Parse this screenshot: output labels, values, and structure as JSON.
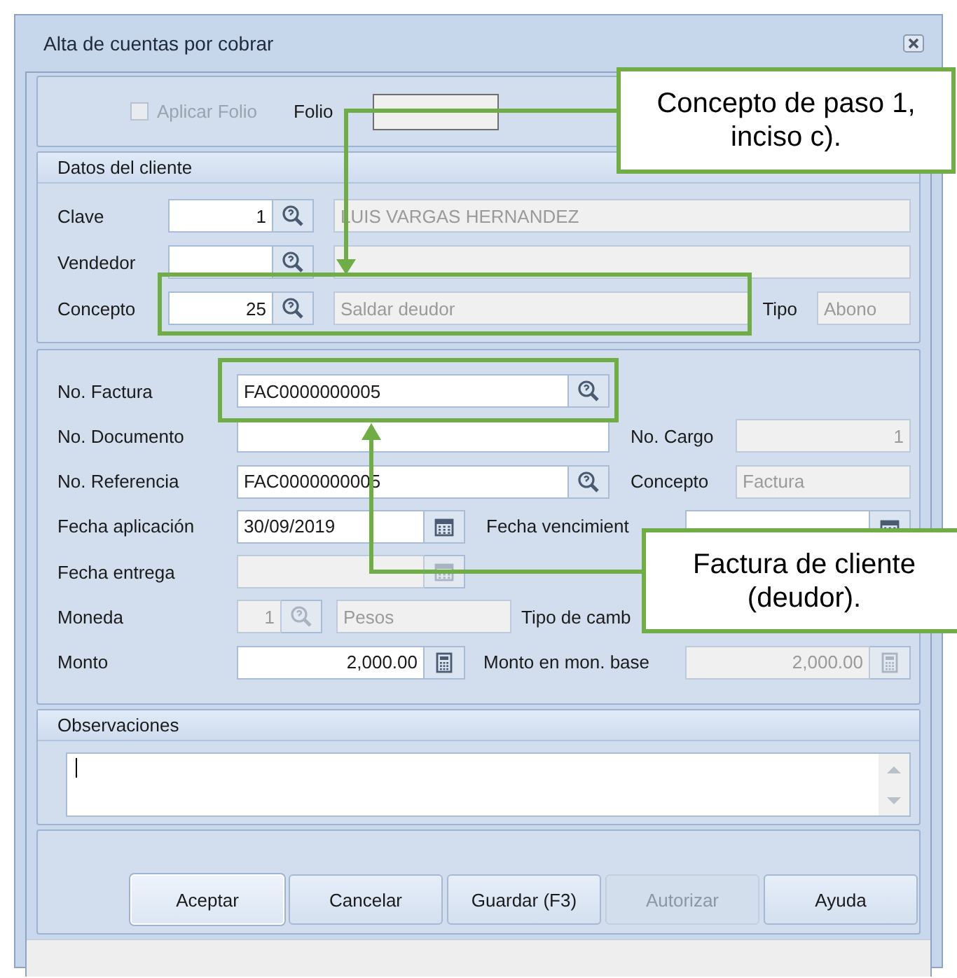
{
  "window": {
    "title": "Alta de cuentas por cobrar"
  },
  "folio": {
    "checkbox": {
      "label": "Aplicar Folio",
      "checked": false,
      "disabled": true
    },
    "label": "Folio"
  },
  "client": {
    "title": "Datos del cliente",
    "rows": [
      {
        "label": "Clave",
        "code": {
          "value": "1",
          "disabled": false
        },
        "name": {
          "value": "LUIS VARGAS HERNANDEZ",
          "disabled": true
        }
      },
      {
        "label": "Vendedor",
        "code": {
          "disabled": false
        },
        "name": {
          "disabled": true
        }
      },
      {
        "label": "Concepto",
        "code": {
          "value": "25",
          "disabled": false
        },
        "name": {
          "value": "Saldar deudor",
          "disabled": true
        },
        "type": {
          "label": "Tipo",
          "value": "Abono",
          "disabled": true
        }
      }
    ]
  },
  "document": {
    "rows": [
      {
        "label": "No. Factura",
        "input": {
          "kind": "lookup",
          "value": "FAC0000000005",
          "disabled": false
        }
      },
      {
        "label": "No. Documento",
        "input": {
          "kind": "text",
          "disabled": false
        },
        "right": {
          "label": "No. Cargo",
          "input": {
            "kind": "number",
            "value": "1",
            "disabled": true
          }
        }
      },
      {
        "label": "No. Referencia",
        "input": {
          "kind": "lookup",
          "value": "FAC0000000005",
          "disabled": false
        },
        "right": {
          "label": "Concepto",
          "input": {
            "kind": "text",
            "value": "Factura",
            "disabled": true
          }
        }
      },
      {
        "label": "Fecha aplicación",
        "input": {
          "kind": "date",
          "value": "30/09/2019",
          "disabled": false
        },
        "right": {
          "label": "Fecha vencimient",
          "input": {
            "kind": "date",
            "disabled": false
          }
        }
      },
      {
        "label": "Fecha entrega",
        "input": {
          "kind": "date",
          "disabled": true
        }
      },
      {
        "label": "Moneda",
        "input": {
          "kind": "currency",
          "value": "1",
          "name": "Pesos",
          "disabled": true
        },
        "right": {
          "label": "Tipo de camb"
        }
      },
      {
        "label": "Monto",
        "input": {
          "kind": "amount",
          "value": "2,000.00",
          "disabled": false
        },
        "right": {
          "label": "Monto en mon. base",
          "input": {
            "kind": "amount",
            "value": "2,000.00",
            "disabled": true
          }
        }
      }
    ]
  },
  "notes": {
    "title": "Observaciones"
  },
  "buttons": [
    {
      "label": "Aceptar",
      "disabled": false,
      "focused": true
    },
    {
      "label": "Cancelar",
      "disabled": false,
      "focused": false
    },
    {
      "label": "Guardar (F3)",
      "disabled": false,
      "focused": false
    },
    {
      "label": "Autorizar",
      "disabled": true,
      "focused": false
    },
    {
      "label": "Ayuda",
      "disabled": false,
      "focused": false
    }
  ],
  "callouts": [
    {
      "text": "Concepto de paso 1, inciso c)."
    },
    {
      "text": "Factura de cliente (deudor)."
    }
  ]
}
